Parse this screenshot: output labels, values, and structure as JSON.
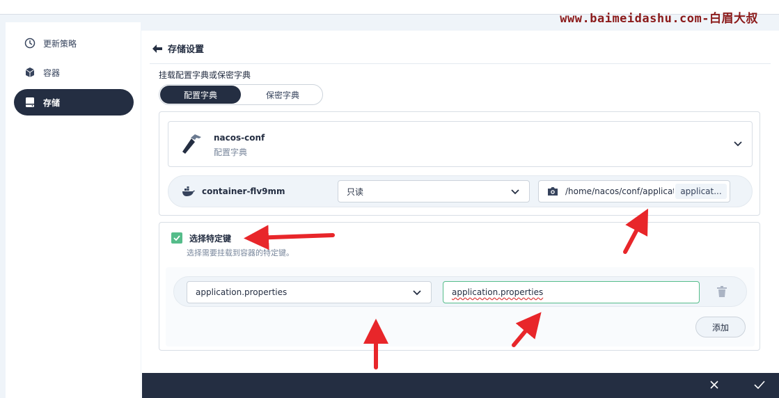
{
  "watermark": "www.baimeidashu.com-白眉大叔",
  "sidebar": {
    "items": [
      {
        "label": "更新策略",
        "icon": "update-strategy-icon"
      },
      {
        "label": "容器",
        "icon": "container-icon"
      },
      {
        "label": "存储",
        "icon": "storage-icon",
        "active": true
      }
    ]
  },
  "page": {
    "back_title": "存储设置",
    "mount_label": "挂载配置字典或保密字典",
    "tabs": [
      {
        "label": "配置字典",
        "active": true
      },
      {
        "label": "保密字典",
        "active": false
      }
    ]
  },
  "config": {
    "name": "nacos-conf",
    "type": "配置字典",
    "icon": "hammer-icon"
  },
  "mount": {
    "container": "container-flv9mm",
    "mode": "只读",
    "path": "/home/nacos/conf/application.properties",
    "sub_path_tag": "applicat..."
  },
  "keys": {
    "checkbox_label": "选择特定键",
    "checkbox_desc": "选择需要挂载到容器的特定键。",
    "checked": true,
    "rows": [
      {
        "key": "application.properties",
        "path": "application.properties"
      }
    ],
    "add_label": "添加"
  },
  "colors": {
    "primary_dark": "#242e42",
    "accent_green": "#55bc8a",
    "annotation_red": "#e8262a",
    "watermark": "#8b1a1a"
  }
}
